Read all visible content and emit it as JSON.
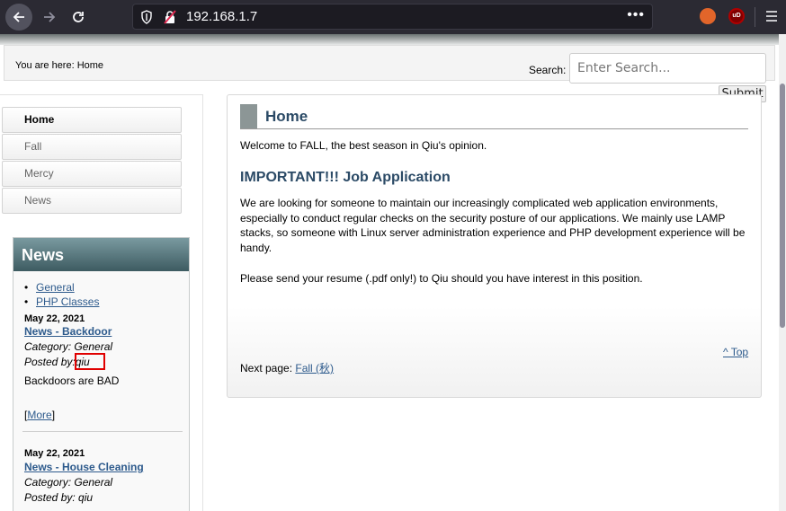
{
  "browser": {
    "url": "192.168.1.7",
    "more_glyph": "•••",
    "ext_badge": "uD"
  },
  "breadcrumb": {
    "text": "You are here: Home"
  },
  "search": {
    "label": "Search:",
    "placeholder": "Enter Search...",
    "submit_label": "Submit"
  },
  "sidebar": {
    "menu": [
      {
        "label": "Home",
        "active": true
      },
      {
        "label": "Fall",
        "active": false
      },
      {
        "label": "Mercy",
        "active": false
      },
      {
        "label": "News",
        "active": false
      }
    ]
  },
  "news": {
    "heading": "News",
    "categories": [
      "General",
      "PHP Classes"
    ],
    "items": [
      {
        "date": "May 22, 2021",
        "title": "News - Backdoor",
        "category": "Category: General",
        "posted_by_label": "Posted by:",
        "posted_by": "qiu",
        "body": "Backdoors are BAD",
        "more_open": "[",
        "more": "More",
        "more_close": "]"
      },
      {
        "date": "May 22, 2021",
        "title": "News - House Cleaning",
        "category": "Category: General",
        "posted_by_label": "Posted by:",
        "posted_by": "qiu"
      }
    ]
  },
  "main": {
    "title": "Home",
    "welcome": "Welcome to FALL, the best season in Qiu's opinion.",
    "heading": "IMPORTANT!!! Job Application",
    "paragraph1": "We are looking for someone to maintain our increasingly complicated web application environments, especially to conduct regular checks on the security posture of our applications. We mainly use LAMP stacks, so someone with Linux server administration experience and PHP development experience will be handy.",
    "paragraph2": "Please send your resume (.pdf only!) to Qiu should you have interest in this position.",
    "top_link": "^ Top",
    "next_label": "Next page:",
    "next_link": "Fall (秋)"
  },
  "colors": {
    "accent": "#2b4a66",
    "link": "#2d5a8c",
    "highlight": "#e00000"
  }
}
